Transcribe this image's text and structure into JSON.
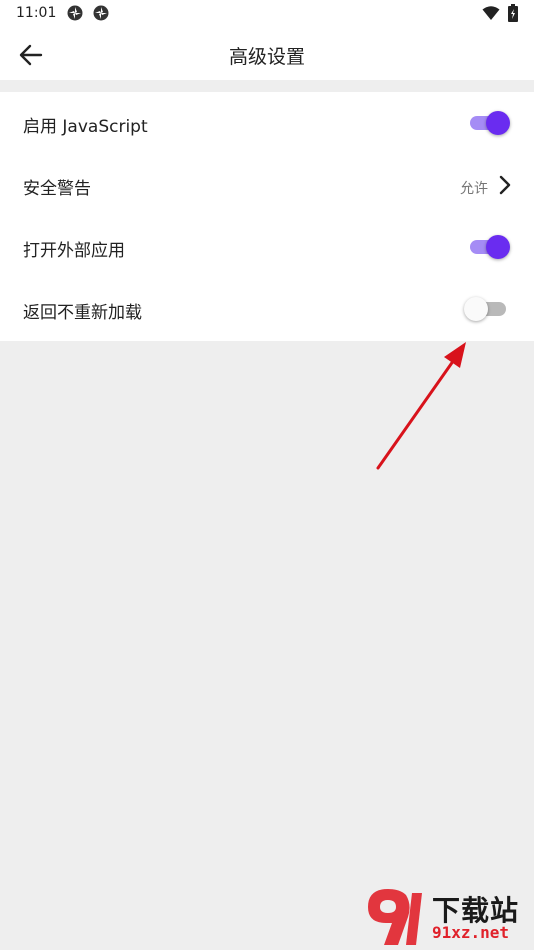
{
  "status_bar": {
    "time": "11:01",
    "icons": [
      "sync-icon",
      "sync-icon",
      "wifi-icon",
      "battery-icon"
    ]
  },
  "app_bar": {
    "title": "高级设置",
    "back_icon": "arrow-left-icon"
  },
  "settings": [
    {
      "label": "启用 JavaScript",
      "type": "switch",
      "on": true
    },
    {
      "label": "安全警告",
      "type": "link",
      "value": "允许",
      "icon": "chevron-right-icon"
    },
    {
      "label": "打开外部应用",
      "type": "switch",
      "on": true
    },
    {
      "label": "返回不重新加载",
      "type": "switch",
      "on": false
    }
  ],
  "colors": {
    "accent": "#6a2cf0",
    "accent_track": "#a58cf5",
    "annotation_arrow": "#d8121b"
  },
  "watermark": {
    "main": "下载站",
    "sub": "91xz.net"
  }
}
